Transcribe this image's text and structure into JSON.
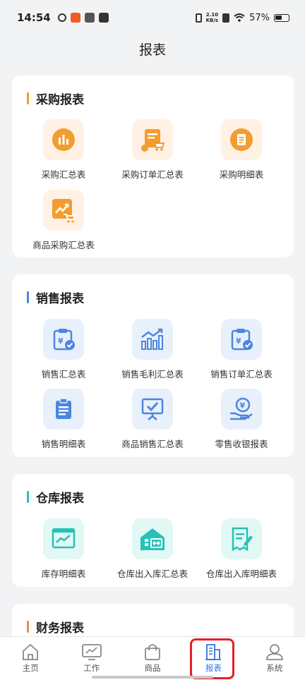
{
  "status": {
    "time": "14:54",
    "net_speed_top": "2.10",
    "net_speed_bottom": "KB/s",
    "battery": "57%"
  },
  "page": {
    "title": "报表"
  },
  "sections": {
    "purchase": {
      "title": "采购报表",
      "accent": "#f39c2f",
      "items": [
        "采购汇总表",
        "采购订单汇总表",
        "采购明细表",
        "商品采购汇总表"
      ]
    },
    "sales": {
      "title": "销售报表",
      "accent": "#4c86de",
      "items": [
        "销售汇总表",
        "销售毛利汇总表",
        "销售订单汇总表",
        "销售明细表",
        "商品销售汇总表",
        "零售收银报表"
      ]
    },
    "warehouse": {
      "title": "仓库报表",
      "accent": "#26c2b6",
      "items": [
        "库存明细表",
        "仓库出入库汇总表",
        "仓库出入库明细表"
      ]
    },
    "finance": {
      "title": "财务报表",
      "accent": "#f08a4b"
    }
  },
  "tabs": [
    {
      "label": "主页"
    },
    {
      "label": "工作"
    },
    {
      "label": "商品"
    },
    {
      "label": "报表"
    },
    {
      "label": "系统"
    }
  ],
  "colors": {
    "orange_tile": "#fff1e3",
    "blue_tile": "#e8f0fc",
    "teal_tile": "#e2f8f5",
    "active_tab": "#2f73e6",
    "highlight": "#e0202a"
  }
}
